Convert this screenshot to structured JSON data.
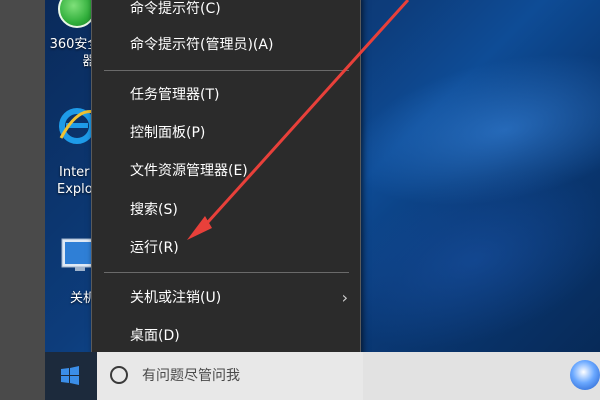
{
  "desktop": {
    "icons": [
      {
        "label_lines": [
          "360安全",
          "器"
        ],
        "icon": "360-security-icon"
      },
      {
        "label_lines": [
          "Inter",
          "Explo"
        ],
        "icon": "internet-explorer-icon"
      },
      {
        "label_lines": [
          "关机"
        ],
        "icon": "this-pc-icon"
      }
    ]
  },
  "context_menu": {
    "items": [
      {
        "label": "命令提示符(C)",
        "name": "menu-item-command-prompt"
      },
      {
        "label": "命令提示符(管理员)(A)",
        "name": "menu-item-command-prompt-admin"
      },
      {
        "label": "任务管理器(T)",
        "name": "menu-item-task-manager"
      },
      {
        "label": "控制面板(P)",
        "name": "menu-item-control-panel"
      },
      {
        "label": "文件资源管理器(E)",
        "name": "menu-item-file-explorer"
      },
      {
        "label": "搜索(S)",
        "name": "menu-item-search"
      },
      {
        "label": "运行(R)",
        "name": "menu-item-run"
      },
      {
        "label": "关机或注销(U)",
        "name": "menu-item-shutdown-signout"
      },
      {
        "label": "桌面(D)",
        "name": "menu-item-desktop"
      }
    ]
  },
  "taskbar": {
    "search_placeholder": "有问题尽管问我"
  },
  "annotation": {
    "arrow_color": "#e8403a"
  },
  "colors": {
    "menu_bg": "#2b2b2b",
    "desktop_blue": "#0d3d7c"
  }
}
